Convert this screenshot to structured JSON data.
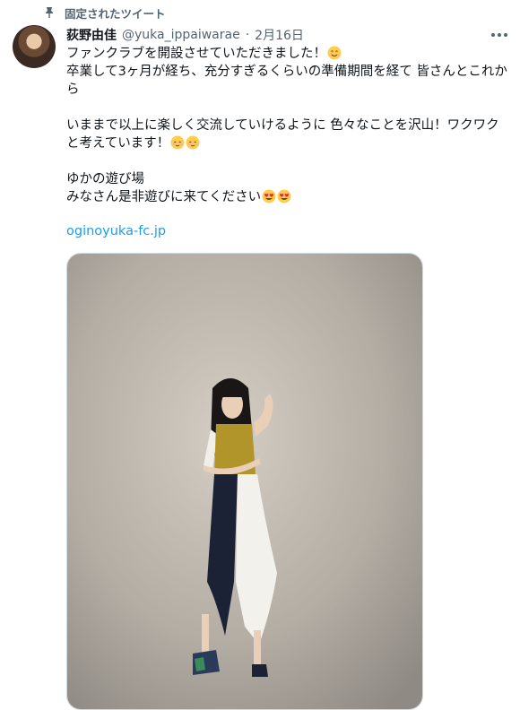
{
  "pinned_label": "固定されたツイート",
  "tweet": {
    "display_name": "荻野由佳",
    "handle": "@yuka_ippaiwarae",
    "separator": "·",
    "date": "2月16日",
    "lines": [
      "ファンクラブを開設させていただきました！",
      "卒業して3ヶ月が経ち、充分すぎるくらいの準備期間を経て 皆さんとこれから",
      "",
      "いままで以上に楽しく交流していけるように 色々なことを沢山！ワクワクと考えています！",
      "",
      "ゆかの遊び場",
      "みなさん是非遊びに来てください"
    ],
    "link": "oginoyuka-fc.jp"
  },
  "icons": {
    "pin": "pin-icon",
    "more": "more-options-icon",
    "smile": "smiling-face-emoji",
    "relieved": "relieved-face-emoji",
    "heart_eyes": "heart-eyes-emoji"
  },
  "colors": {
    "link": "#1d9bf0",
    "secondary_text": "#536471",
    "primary_text": "#0f1419"
  }
}
